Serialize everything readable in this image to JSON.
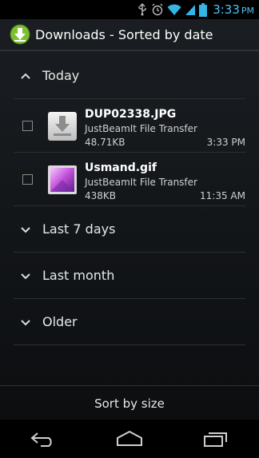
{
  "status_bar": {
    "time": "3:33",
    "ampm": "PM",
    "icons": [
      "usb-icon",
      "alarm-icon",
      "wifi-icon",
      "signal-icon",
      "battery-icon"
    ]
  },
  "action_bar": {
    "app_icon": "download-arrow-icon",
    "title": "Downloads - Sorted by date"
  },
  "groups": [
    {
      "label": "Today",
      "expanded": true,
      "items": [
        {
          "name": "DUP02338.JPG",
          "source": "JustBeamIt File Transfer",
          "size": "48.71KB",
          "time": "3:33 PM",
          "icon": "download-file-icon",
          "checked": false
        },
        {
          "name": "Usmand.gif",
          "source": "JustBeamIt File Transfer",
          "size": "438KB",
          "time": "11:35 AM",
          "icon": "image-gallery-icon",
          "checked": false
        }
      ]
    },
    {
      "label": "Last 7 days",
      "expanded": false
    },
    {
      "label": "Last month",
      "expanded": false
    },
    {
      "label": "Older",
      "expanded": false
    }
  ],
  "bottom": {
    "sort_label": "Sort by size"
  },
  "nav": [
    "back-icon",
    "home-icon",
    "recent-apps-icon"
  ],
  "colors": {
    "clock": "#4fc3f7",
    "app_icon_green": "#7cbf2f"
  }
}
